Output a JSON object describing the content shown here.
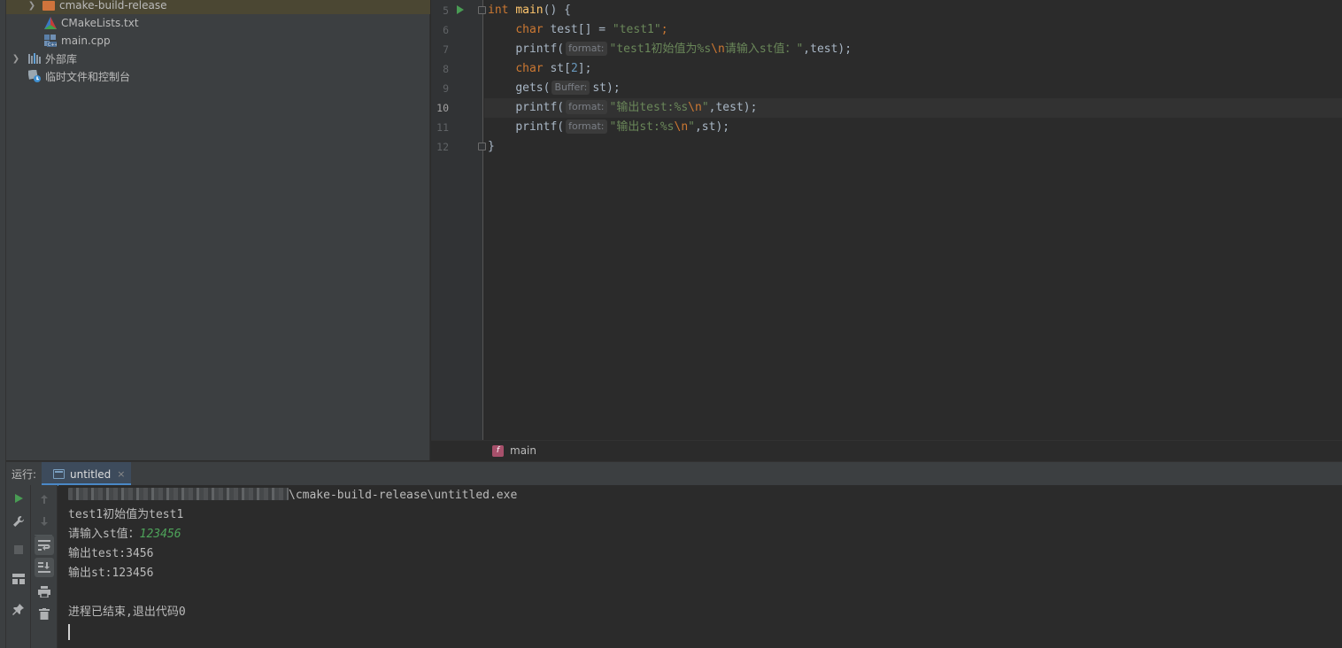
{
  "project_tree": {
    "items": [
      {
        "label": "cmake-build-release",
        "icon": "folder-icon"
      },
      {
        "label": "CMakeLists.txt",
        "icon": "cmake-file-icon"
      },
      {
        "label": "main.cpp",
        "icon": "cpp-file-icon"
      },
      {
        "label": "外部库",
        "icon": "library-icon"
      },
      {
        "label": "临时文件和控制台",
        "icon": "scratch-icon"
      }
    ]
  },
  "editor": {
    "line_numbers": [
      "5",
      "6",
      "7",
      "8",
      "9",
      "10",
      "11",
      "12"
    ],
    "current_line": "10",
    "lines": {
      "l5": {
        "kw": "int",
        "fn": "main",
        "rest": "() {"
      },
      "l6": {
        "kw": "char",
        "mid": " test[] = ",
        "str": "\"test1\"",
        "end": ";"
      },
      "l7": {
        "fn": "printf(",
        "hint": "format:",
        "str_a": "\"test1初始值为%s",
        "esc": "\\n",
        "str_b": "请输入st值：\"",
        "end": ",test);"
      },
      "l8": {
        "kw": "char",
        "mid": " st[",
        "num": "2",
        "end": "];"
      },
      "l9": {
        "fn": "gets(",
        "hint": "Buffer:",
        "end": "st);"
      },
      "l10": {
        "fn": "printf(",
        "hint": "format:",
        "str_a": "\"输出test:%s",
        "esc": "\\n",
        "str_b": "\"",
        "end": ",test);"
      },
      "l11": {
        "fn": "printf(",
        "hint": "format:",
        "str_a": "\"输出st:%s",
        "esc": "\\n",
        "str_b": "\"",
        "end": ",st);"
      },
      "l12": {
        "rest": "}"
      }
    }
  },
  "breadcrumb": {
    "badge": "f",
    "label": "main"
  },
  "run_window": {
    "label": "运行:",
    "tab_label": "untitled",
    "tab_close": "×",
    "console": {
      "path_suffix": "\\cmake-build-release\\untitled.exe",
      "line1": "test1初始值为test1",
      "line2_prompt": "请输入st值：",
      "line2_input": "123456",
      "line3": "输出test:3456",
      "line4": "输出st:123456",
      "line6": "进程已结束,退出代码0"
    }
  },
  "colors": {
    "accent": "#4a88c7",
    "keyword": "#cc7832",
    "string": "#6a8759",
    "function": "#ffc66d",
    "run_green": "#499c54"
  }
}
